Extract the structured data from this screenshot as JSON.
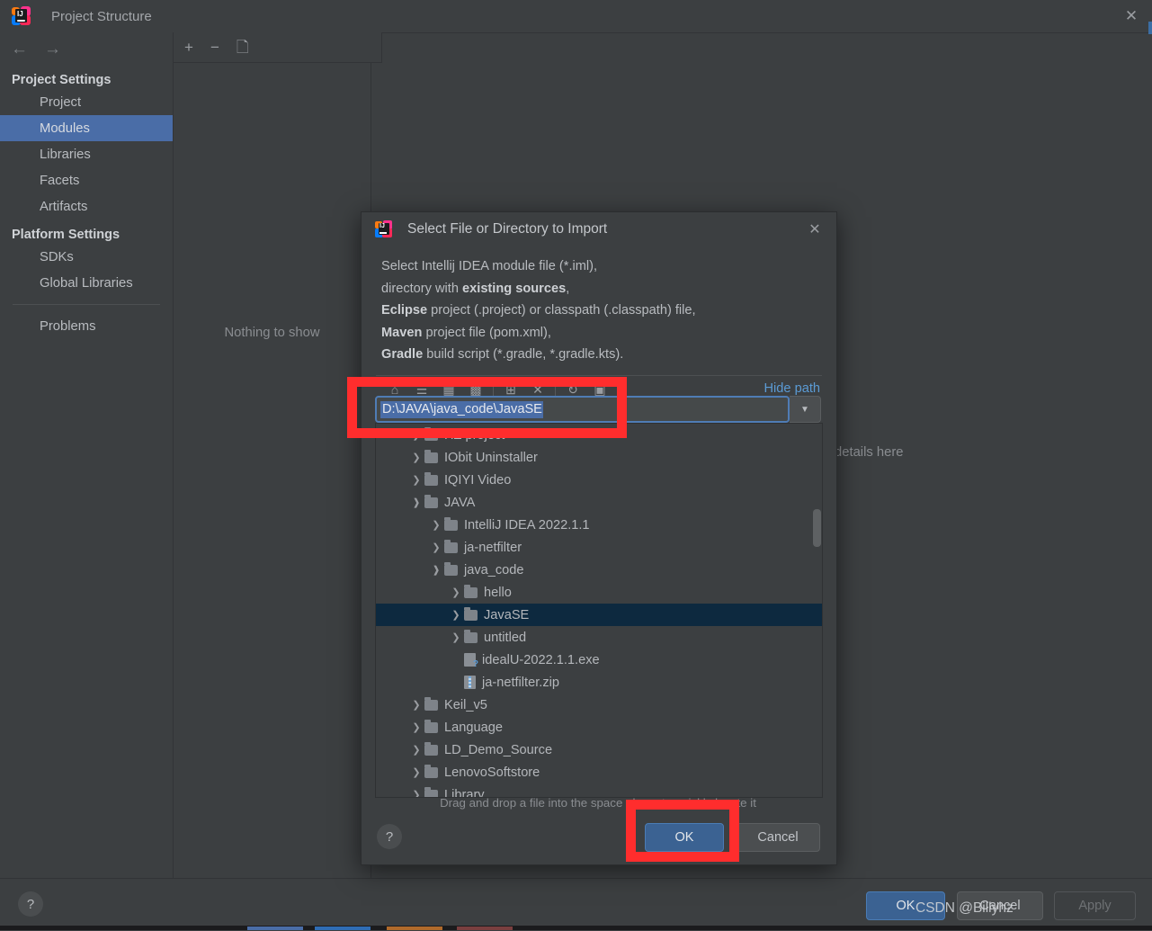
{
  "window": {
    "title": "Project Structure",
    "logo_icon": "intellij-idea-logo",
    "close_icon": "close-icon",
    "back_icon": "arrow-left-icon",
    "forward_icon": "arrow-right-icon"
  },
  "sidebar": {
    "groups": [
      {
        "label": "Project Settings",
        "items": [
          {
            "label": "Project",
            "selected": false
          },
          {
            "label": "Modules",
            "selected": true
          },
          {
            "label": "Libraries",
            "selected": false
          },
          {
            "label": "Facets",
            "selected": false
          },
          {
            "label": "Artifacts",
            "selected": false
          }
        ]
      },
      {
        "label": "Platform Settings",
        "items": [
          {
            "label": "SDKs",
            "selected": false
          },
          {
            "label": "Global Libraries",
            "selected": false
          }
        ]
      }
    ],
    "problems_label": "Problems",
    "selected_color": "#4a6da7"
  },
  "modules_panel": {
    "toolbar": {
      "add_icon": "plus-icon",
      "remove_icon": "minus-icon",
      "copy_icon": "copy-icon"
    },
    "empty_text": "Nothing to show"
  },
  "right_panel": {
    "hint_text": "details here"
  },
  "main_buttons": {
    "help_label": "?",
    "ok_label": "OK",
    "cancel_label": "Cancel",
    "apply_label": "Apply"
  },
  "watermark": "CSDN @Billyhz",
  "dialog": {
    "logo_icon": "intellij-idea-logo",
    "title": "Select File or Directory to Import",
    "close_icon": "close-icon",
    "description_lines": [
      [
        {
          "t": "Select Intellij IDEA module file (*.iml),",
          "b": false
        }
      ],
      [
        {
          "t": "directory with ",
          "b": false
        },
        {
          "t": "existing sources",
          "b": true
        },
        {
          "t": ",",
          "b": false
        }
      ],
      [
        {
          "t": "Eclipse",
          "b": true
        },
        {
          "t": " project (.project) or classpath (.classpath) file,",
          "b": false
        }
      ],
      [
        {
          "t": "Maven",
          "b": true
        },
        {
          "t": " project file (pom.xml),",
          "b": false
        }
      ],
      [
        {
          "t": "Gradle",
          "b": true
        },
        {
          "t": " build script (*.gradle, *.gradle.kts).",
          "b": false
        }
      ]
    ],
    "toolbar_icons": [
      "home-icon",
      "desktop-icon",
      "project-dir-icon",
      "module-dir-icon",
      "new-folder-icon",
      "delete-icon",
      "refresh-icon",
      "show-hidden-icon"
    ],
    "hide_path_label": "Hide path",
    "path_value": "D:\\JAVA\\java_code\\JavaSE",
    "path_dropdown_icon": "chevron-down-icon",
    "tree": [
      {
        "label": "HZ project",
        "indent": 1,
        "state": "collapsed",
        "icon": "folder-icon",
        "selected": false,
        "clipped": true
      },
      {
        "label": "IObit Uninstaller",
        "indent": 1,
        "state": "collapsed",
        "icon": "folder-icon",
        "selected": false
      },
      {
        "label": "IQIYI Video",
        "indent": 1,
        "state": "collapsed",
        "icon": "folder-icon",
        "selected": false
      },
      {
        "label": "JAVA",
        "indent": 1,
        "state": "expanded",
        "icon": "folder-icon",
        "selected": false
      },
      {
        "label": "IntelliJ IDEA 2022.1.1",
        "indent": 2,
        "state": "collapsed",
        "icon": "folder-icon",
        "selected": false
      },
      {
        "label": "ja-netfilter",
        "indent": 2,
        "state": "collapsed",
        "icon": "folder-icon",
        "selected": false
      },
      {
        "label": "java_code",
        "indent": 2,
        "state": "expanded",
        "icon": "folder-icon",
        "selected": false
      },
      {
        "label": "hello",
        "indent": 3,
        "state": "collapsed",
        "icon": "folder-icon",
        "selected": false
      },
      {
        "label": "JavaSE",
        "indent": 3,
        "state": "collapsed",
        "icon": "folder-icon",
        "selected": true
      },
      {
        "label": "untitled",
        "indent": 3,
        "state": "collapsed",
        "icon": "folder-icon",
        "selected": false
      },
      {
        "label": "idealU-2022.1.1.exe",
        "indent": 3,
        "state": "leaf",
        "icon": "exe-file-icon",
        "selected": false
      },
      {
        "label": "ja-netfilter.zip",
        "indent": 3,
        "state": "leaf",
        "icon": "zip-file-icon",
        "selected": false
      },
      {
        "label": "Keil_v5",
        "indent": 1,
        "state": "collapsed",
        "icon": "folder-icon",
        "selected": false
      },
      {
        "label": "Language",
        "indent": 1,
        "state": "collapsed",
        "icon": "folder-icon",
        "selected": false
      },
      {
        "label": "LD_Demo_Source",
        "indent": 1,
        "state": "collapsed",
        "icon": "folder-icon",
        "selected": false
      },
      {
        "label": "LenovoSoftstore",
        "indent": 1,
        "state": "collapsed",
        "icon": "folder-icon",
        "selected": false
      },
      {
        "label": "Library",
        "indent": 1,
        "state": "collapsed",
        "icon": "folder-icon",
        "selected": false,
        "clipped": true
      }
    ],
    "drag_hint": "Drag and drop a file into the space above to quickly locate it",
    "help_label": "?",
    "ok_label": "OK",
    "cancel_label": "Cancel"
  },
  "annotations": {
    "color": "#ff2d2d",
    "boxes": [
      "path-field-highlight",
      "ok-button-highlight"
    ]
  }
}
